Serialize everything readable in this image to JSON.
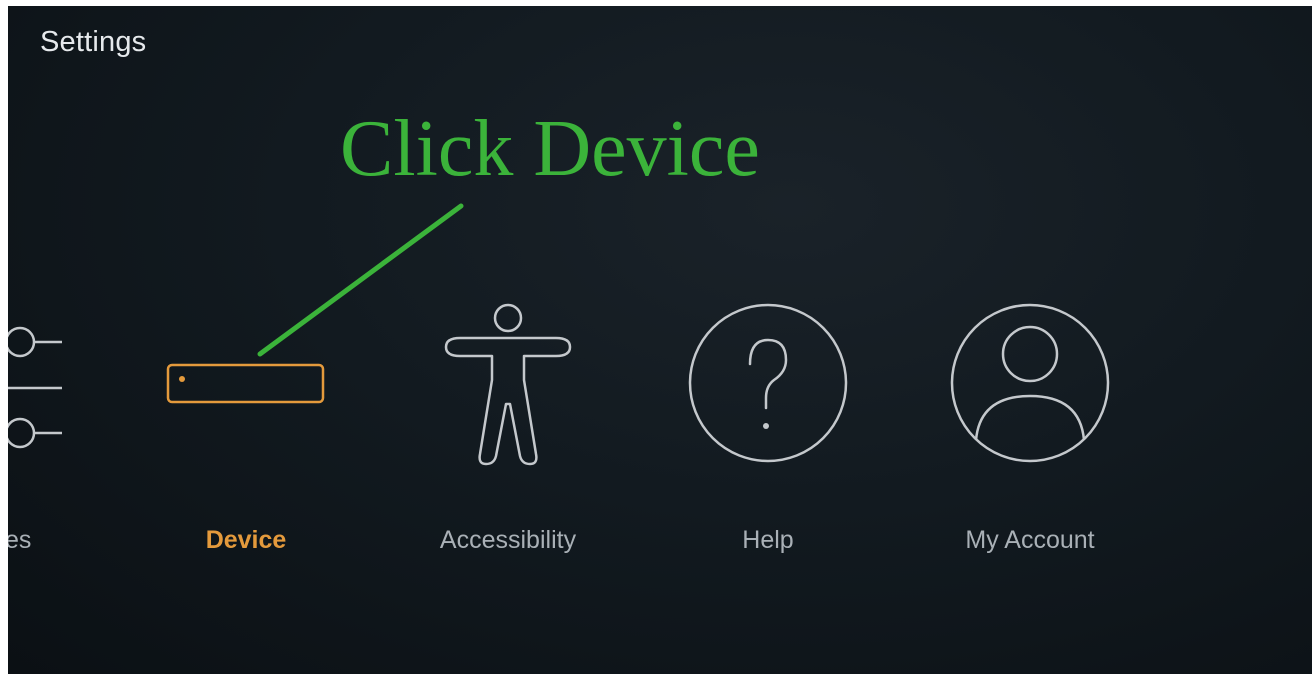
{
  "header": {
    "title": "Settings"
  },
  "annotation": {
    "text": "Click Device",
    "color": "#3bb33a"
  },
  "menu": {
    "selected": "Device",
    "selected_color": "#e49a3c",
    "items": [
      {
        "label": "nces",
        "icon": "sliders-icon"
      },
      {
        "label": "Device",
        "icon": "device-box-icon"
      },
      {
        "label": "Accessibility",
        "icon": "accessibility-person-icon"
      },
      {
        "label": "Help",
        "icon": "question-circle-icon"
      },
      {
        "label": "My Account",
        "icon": "user-circle-icon"
      }
    ]
  }
}
